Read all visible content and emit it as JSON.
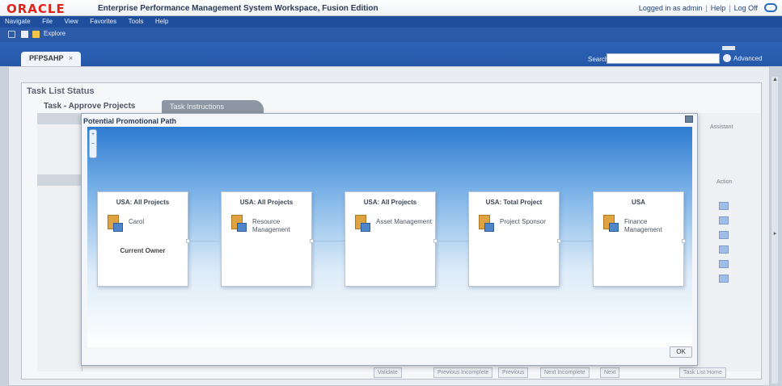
{
  "header": {
    "logo": "ORACLE",
    "title": "Enterprise Performance Management System Workspace, Fusion Edition",
    "logged_in": "Logged in as admin",
    "help": "Help",
    "logoff": "Log Off"
  },
  "menu": {
    "items": [
      "Navigate",
      "File",
      "View",
      "Favorites",
      "Tools",
      "Help"
    ]
  },
  "toolbar": {
    "explore": "Explore"
  },
  "tabs": {
    "active": "PFPSAHP",
    "close": "×"
  },
  "search": {
    "label": "Search",
    "value": "",
    "advanced": "Advanced"
  },
  "panel": {
    "title": "Task List Status",
    "tab1": "Task - Approve Projects",
    "tab2": "Task Instructions",
    "right_label": "Assistant",
    "action_header": "Action"
  },
  "modal": {
    "title": "Potential Promotional Path",
    "zoom_in": "+",
    "zoom_out": "–",
    "ok": "OK",
    "nodes": [
      {
        "title": "USA: All Projects",
        "label": "Carol",
        "owner": "Current Owner"
      },
      {
        "title": "USA: All Projects",
        "label": "Resource Management",
        "owner": ""
      },
      {
        "title": "USA: All Projects",
        "label": "Asset Management",
        "owner": ""
      },
      {
        "title": "USA: Total Project",
        "label": "Project Sponsor",
        "owner": ""
      },
      {
        "title": "USA",
        "label": "Finance Management",
        "owner": ""
      }
    ]
  },
  "bottom": {
    "buttons": [
      "Validate",
      "Previous Incomplete",
      "Previous",
      "Next Incomplete",
      "Next",
      "Task List Home"
    ]
  }
}
